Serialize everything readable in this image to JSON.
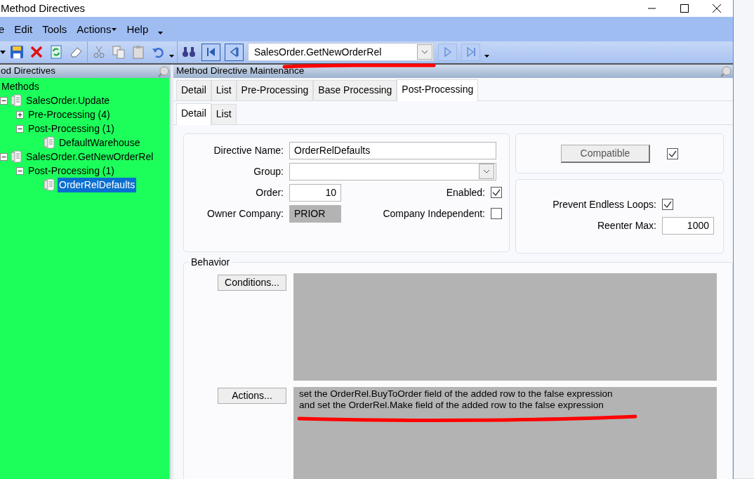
{
  "window": {
    "title": "Method Directives"
  },
  "menu": [
    {
      "label": "e",
      "dropdown": false
    },
    {
      "label": "Edit",
      "dropdown": false
    },
    {
      "label": "Tools",
      "dropdown": false
    },
    {
      "label": "Actions",
      "dropdown": true
    },
    {
      "label": "Help",
      "dropdown": false
    }
  ],
  "toolbar": {
    "record": "SalesOrder.GetNewOrderRel",
    "nav": [
      {
        "kind": "first",
        "disabled": false
      },
      {
        "kind": "prev",
        "disabled": false
      },
      {
        "kind": "next",
        "disabled": true
      },
      {
        "kind": "last",
        "disabled": true
      }
    ]
  },
  "tree_panel": {
    "title": "od Directives",
    "tree": [
      {
        "label": "Methods",
        "kind": "root",
        "children": [
          {
            "label": "SalesOrder.Update",
            "kind": "method",
            "expanded": true,
            "children": [
              {
                "label": "Pre-Processing (4)",
                "kind": "group",
                "expanded": false
              },
              {
                "label": "Post-Processing (1)",
                "kind": "group",
                "expanded": true,
                "children": [
                  {
                    "label": "DefaultWarehouse",
                    "kind": "directive",
                    "selected": false
                  }
                ]
              }
            ]
          },
          {
            "label": "SalesOrder.GetNewOrderRel",
            "kind": "method",
            "expanded": true,
            "children": [
              {
                "label": "Post-Processing (1)",
                "kind": "group",
                "expanded": true,
                "children": [
                  {
                    "label": "OrderRelDefaults",
                    "kind": "directive",
                    "selected": true
                  }
                ]
              }
            ]
          }
        ]
      }
    ]
  },
  "main_panel": {
    "title": "Method Directive Maintenance",
    "tabs": [
      {
        "label": "Detail",
        "selected": false
      },
      {
        "label": "List",
        "selected": false
      },
      {
        "label": "Pre-Processing",
        "selected": false
      },
      {
        "label": "Base Processing",
        "selected": false
      },
      {
        "label": "Post-Processing",
        "selected": true
      }
    ],
    "subtabs": [
      {
        "label": "Detail",
        "selected": true
      },
      {
        "label": "List",
        "selected": false
      }
    ],
    "directive_name": {
      "label": "Directive Name:",
      "value": "OrderRelDefaults"
    },
    "group": {
      "label": "Group:"
    },
    "order": {
      "label": "Order:",
      "value": "10"
    },
    "owner_company": {
      "label": "Owner Company:",
      "value": "PRIOR"
    },
    "enabled": {
      "label": "Enabled:",
      "checked": true
    },
    "company_independent": {
      "label": "Company Independent:",
      "checked": false
    },
    "compatible": {
      "label": "Compatible",
      "checked": true
    },
    "prevent_endless_loops": {
      "label": "Prevent Endless Loops:",
      "checked": true
    },
    "reenter_max": {
      "label": "Reenter Max:",
      "value": "1000"
    },
    "behavior": {
      "title": "Behavior",
      "conditions_button": "Conditions...",
      "actions_button": "Actions...",
      "actions_text": [
        "set the OrderRel.BuyToOrder field of the added row to the  false  expression",
        "and set the OrderRel.Make field of the added row to the  false  expression"
      ]
    }
  }
}
